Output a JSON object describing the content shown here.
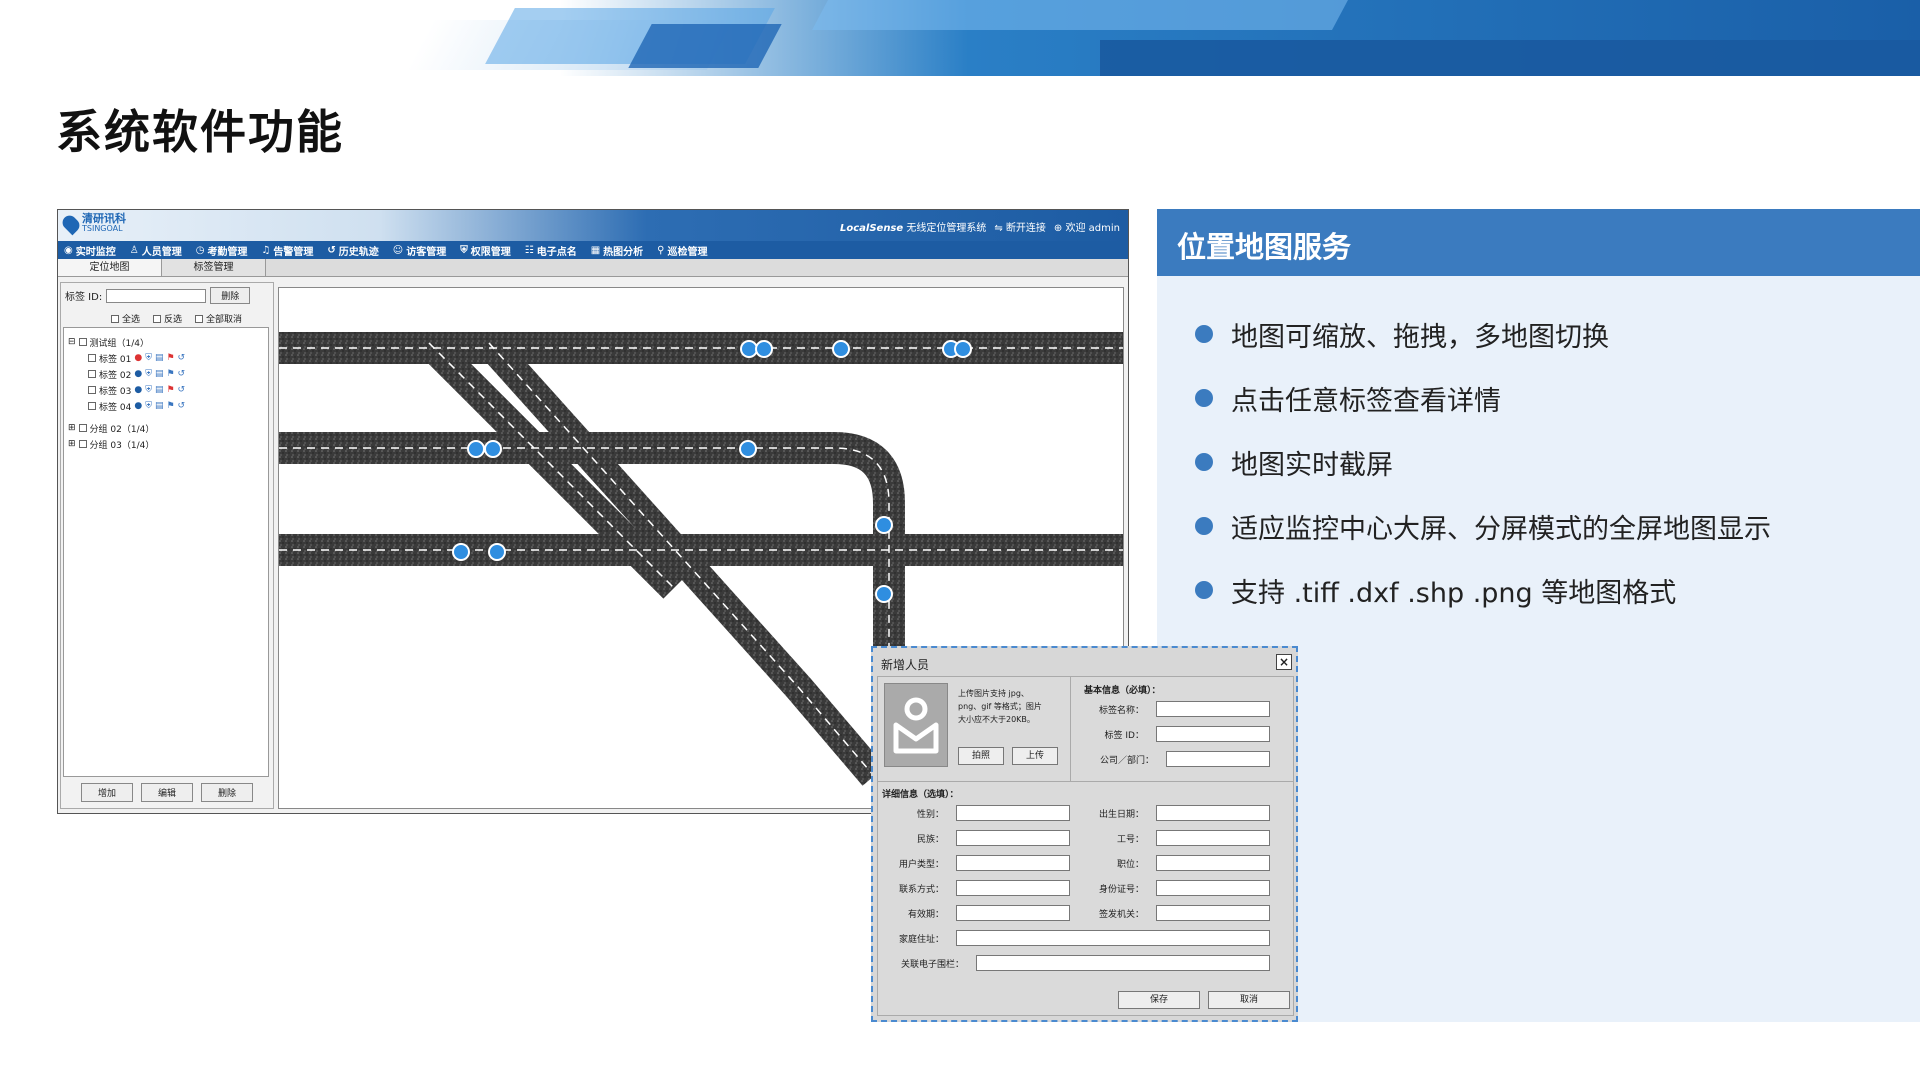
{
  "page": {
    "title": "系统软件功能"
  },
  "app": {
    "logo_cn": "清研讯科",
    "logo_en": "TSINGOAL",
    "brand": "LocalSense",
    "system_name": "无线定位管理系统",
    "disconnect": "断开连接",
    "welcome": "欢迎 admin",
    "menu": [
      {
        "icon": "eye-icon",
        "label": "实时监控"
      },
      {
        "icon": "people-icon",
        "label": "人员管理"
      },
      {
        "icon": "clock-icon",
        "label": "考勤管理"
      },
      {
        "icon": "bell-icon",
        "label": "告警管理"
      },
      {
        "icon": "history-icon",
        "label": "历史轨迹"
      },
      {
        "icon": "visitor-icon",
        "label": "访客管理"
      },
      {
        "icon": "shield-icon",
        "label": "权限管理"
      },
      {
        "icon": "rollcall-icon",
        "label": "电子点名"
      },
      {
        "icon": "heatmap-icon",
        "label": "热图分析"
      },
      {
        "icon": "patrol-icon",
        "label": "巡检管理"
      }
    ],
    "tabs": [
      "定位地图",
      "标签管理"
    ],
    "left": {
      "tag_id_label": "标签 ID:",
      "delete_label": "删除",
      "select_all": "全选",
      "invert": "反选",
      "deselect_all": "全部取消",
      "group_test": "测试组（1/4）",
      "tags": [
        "标签 01",
        "标签 02",
        "标签 03",
        "标签 04"
      ],
      "group2": "分组 02（1/4）",
      "group3": "分组 03（1/4）",
      "add": "增加",
      "edit": "编辑",
      "remove": "删除"
    }
  },
  "panel": {
    "title": "位置地图服务",
    "bullets": [
      "地图可缩放、拖拽，多地图切换",
      "点击任意标签查看详情",
      "地图实时截屏",
      "适应监控中心大屏、分屏模式的全屏地图显示",
      "支持 .tiff .dxf .shp .png 等地图格式"
    ],
    "accent": "#3b7bbf"
  },
  "dialog": {
    "title": "新增人员",
    "upload_hint": "上传图片支持 jpg、png、gif 等格式；图片大小应不大于20KB。",
    "photo_btn": "拍照",
    "upload_btn": "上传",
    "basic_title": "基本信息（必填）：",
    "basic_fields": [
      "标签名称：",
      "标签 ID：",
      "公司／部门："
    ],
    "detail_title": "详细信息（选填）：",
    "detail_left": [
      "性别：",
      "民族：",
      "用户类型：",
      "联系方式：",
      "有效期："
    ],
    "detail_right": [
      "出生日期：",
      "工号：",
      "职位：",
      "身份证号：",
      "签发机关："
    ],
    "address": "家庭住址：",
    "fence": "关联电子围栏：",
    "save": "保存",
    "cancel": "取消"
  }
}
